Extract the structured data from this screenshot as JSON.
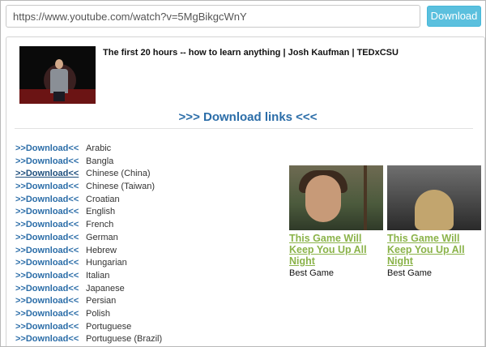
{
  "url_bar": {
    "value": "https://www.youtube.com/watch?v=5MgBikgcWnY",
    "button_label": "Download"
  },
  "video": {
    "title": "The first 20 hours -- how to learn anything | Josh Kaufman | TEDxCSU"
  },
  "links_header": ">>> Download links <<<",
  "download_label": ">>Download<<",
  "languages": [
    "Arabic",
    "Bangla",
    "Chinese (China)",
    "Chinese (Taiwan)",
    "Croatian",
    "English",
    "French",
    "German",
    "Hebrew",
    "Hungarian",
    "Italian",
    "Japanese",
    "Persian",
    "Polish",
    "Portuguese",
    "Portuguese (Brazil)"
  ],
  "ads": [
    {
      "title": "This Game Will Keep You Up All Night",
      "subtitle": "Best Game"
    },
    {
      "title": "This Game Will Keep You Up All Night",
      "subtitle": "Best Game"
    }
  ],
  "colors": {
    "link": "#2b6da8",
    "button": "#5bc0de",
    "ad_title": "#8bb34a"
  }
}
